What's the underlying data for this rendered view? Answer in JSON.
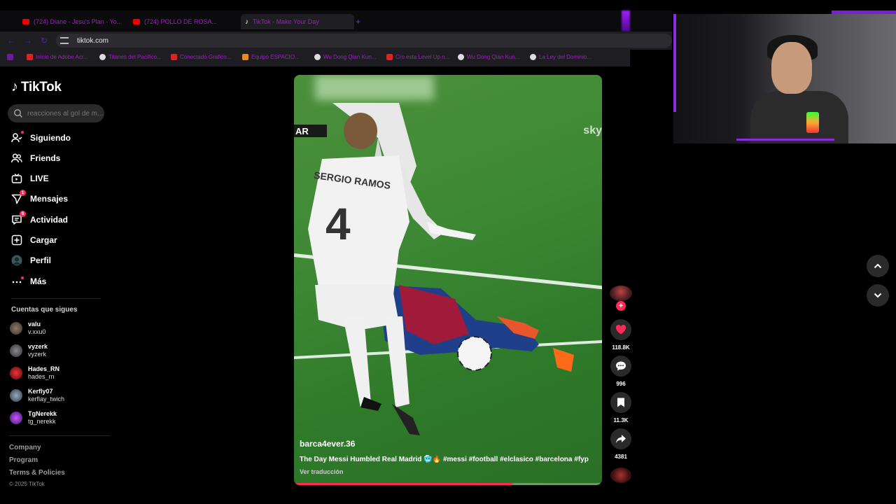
{
  "browser": {
    "tabs": [
      {
        "label": "(724) Diane - Jesu's Plan - Yo..."
      },
      {
        "label": "(724) POLLO DE ROSA..."
      },
      {
        "label": "TikTok - Make Your Day"
      }
    ],
    "new_tab": "+",
    "url": "tiktok.com",
    "bookmarks": [
      "Inicio de Adobe Acr...",
      "Titanes del Pacifico...",
      "Conectado Grafico...",
      "Equipo ESPACIO...",
      "Wu Dong Qian Kun...",
      "Cro esta Level Up n...",
      "Wu Dong Qian Kun...",
      "La Ley del Dominio..."
    ]
  },
  "sidebar": {
    "logo": "TikTok",
    "search_placeholder": "reacciones al gol de m...",
    "nav": [
      {
        "label": "Siguiendo",
        "icon": "following-icon"
      },
      {
        "label": "Friends",
        "icon": "friends-icon"
      },
      {
        "label": "LIVE",
        "icon": "live-icon"
      },
      {
        "label": "Mensajes",
        "icon": "messages-icon",
        "badge": "1"
      },
      {
        "label": "Actividad",
        "icon": "activity-icon",
        "badge": "6"
      },
      {
        "label": "Cargar",
        "icon": "upload-icon"
      },
      {
        "label": "Perfil",
        "icon": "profile-icon"
      },
      {
        "label": "Más",
        "icon": "more-icon"
      }
    ],
    "following_title": "Cuentas que sigues",
    "accounts": [
      {
        "name": "valu",
        "handle": "v.xxu0"
      },
      {
        "name": "vyzerk",
        "handle": "vyzerk"
      },
      {
        "name": "Hades_RN",
        "handle": "hades_rn"
      },
      {
        "name": "Kerfly07",
        "handle": "kerflay_twich"
      },
      {
        "name": "TgNerekk",
        "handle": "tg_nerekk"
      }
    ],
    "footer": [
      "Company",
      "Program",
      "Terms & Policies"
    ],
    "copyright": "© 2025 TikTok"
  },
  "video": {
    "username": "barca4ever.36",
    "description": "The Day Messi Humbled Real Madrid 🥶🔥 #messi #football #elclasico #barcelona #fyp",
    "translate": "Ver traducción",
    "jersey_name": "SERGIO RAMOS",
    "jersey_number": "4",
    "scorebug": "AR",
    "broadcaster": "sky",
    "progress": 0.71
  },
  "actions": {
    "likes": "118.8K",
    "comments": "996",
    "saves": "11.3K",
    "shares": "4381",
    "follow": "+"
  },
  "colors": {
    "accent": "#fe2c55",
    "stream_purple": "#8a2be2"
  }
}
